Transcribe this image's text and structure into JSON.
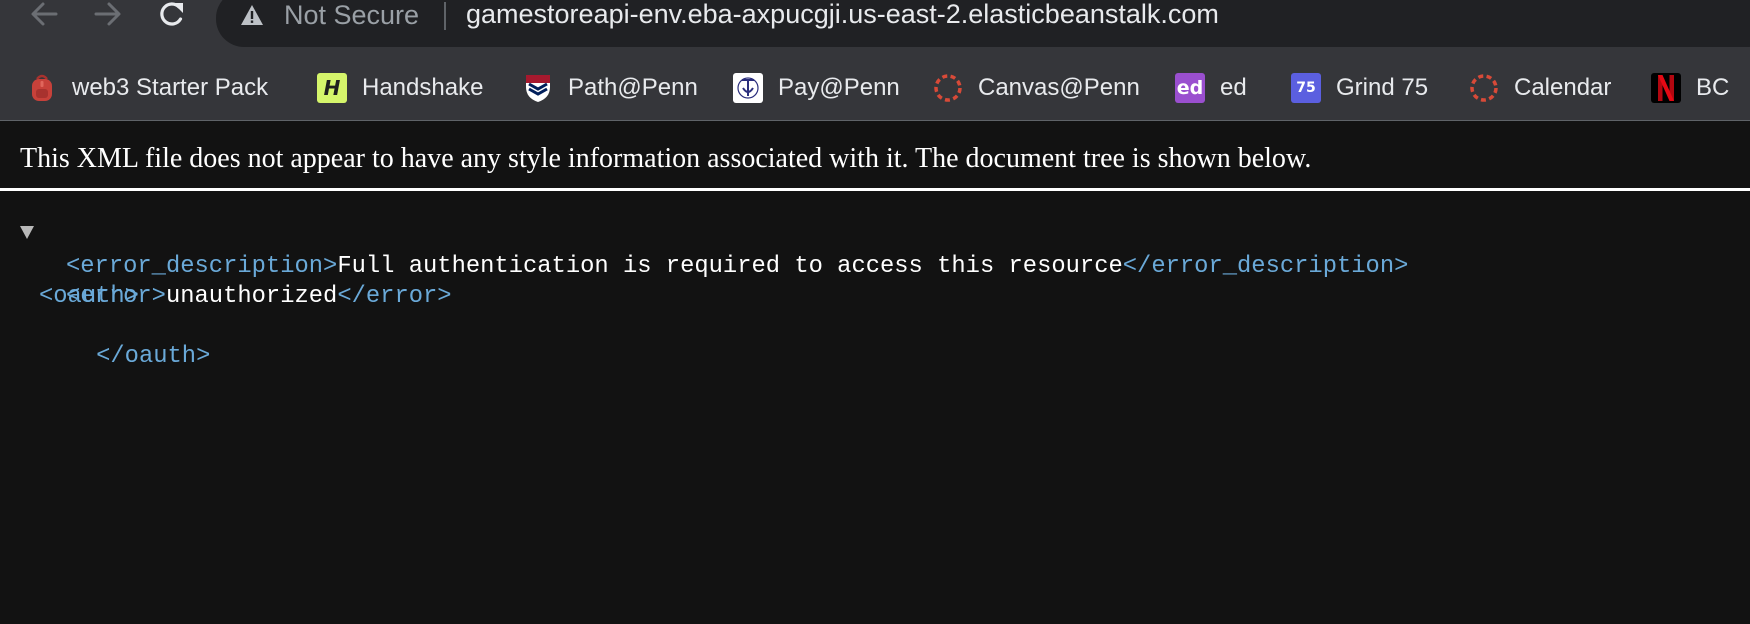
{
  "toolbar": {
    "back_icon": "arrow-left-icon",
    "forward_icon": "arrow-right-icon",
    "reload_icon": "reload-icon"
  },
  "omnibox": {
    "security_icon": "warning-triangle-icon",
    "security_label": "Not Secure",
    "url": "gamestoreapi-env.eba-axpucgji.us-east-2.elasticbeanstalk.com"
  },
  "bookmarks": [
    {
      "label": "web3 Starter Pack",
      "icon": "backpack-icon"
    },
    {
      "label": "Handshake",
      "icon": "handshake-logo-icon"
    },
    {
      "label": "Path@Penn",
      "icon": "penn-shield-icon"
    },
    {
      "label": "Pay@Penn",
      "icon": "pay-penn-logo-icon"
    },
    {
      "label": "Canvas@Penn",
      "icon": "canvas-logo-icon"
    },
    {
      "label": "ed",
      "icon": "ed-logo-icon",
      "icon_text": "ed"
    },
    {
      "label": "Grind 75",
      "icon": "grind75-logo-icon",
      "icon_text": "75"
    },
    {
      "label": "Calendar",
      "icon": "canvas-logo-icon"
    },
    {
      "label": "BC",
      "icon": "netflix-logo-icon"
    }
  ],
  "document": {
    "info": "This XML file does not appear to have any style information associated with it. The document tree is shown below.",
    "xml": {
      "root_open": "<oauth>",
      "desc_open": "<error_description>",
      "desc_text": "Full authentication is required to access this resource",
      "desc_close": "</error_description>",
      "error_open": "<error>",
      "error_text": "unauthorized",
      "error_close": "</error>",
      "root_close": "</oauth>"
    }
  },
  "colors": {
    "page_background": "#121212",
    "chrome": "#35363a",
    "xml_tag": "#6aa9d8",
    "xml_text": "#ffffff"
  }
}
